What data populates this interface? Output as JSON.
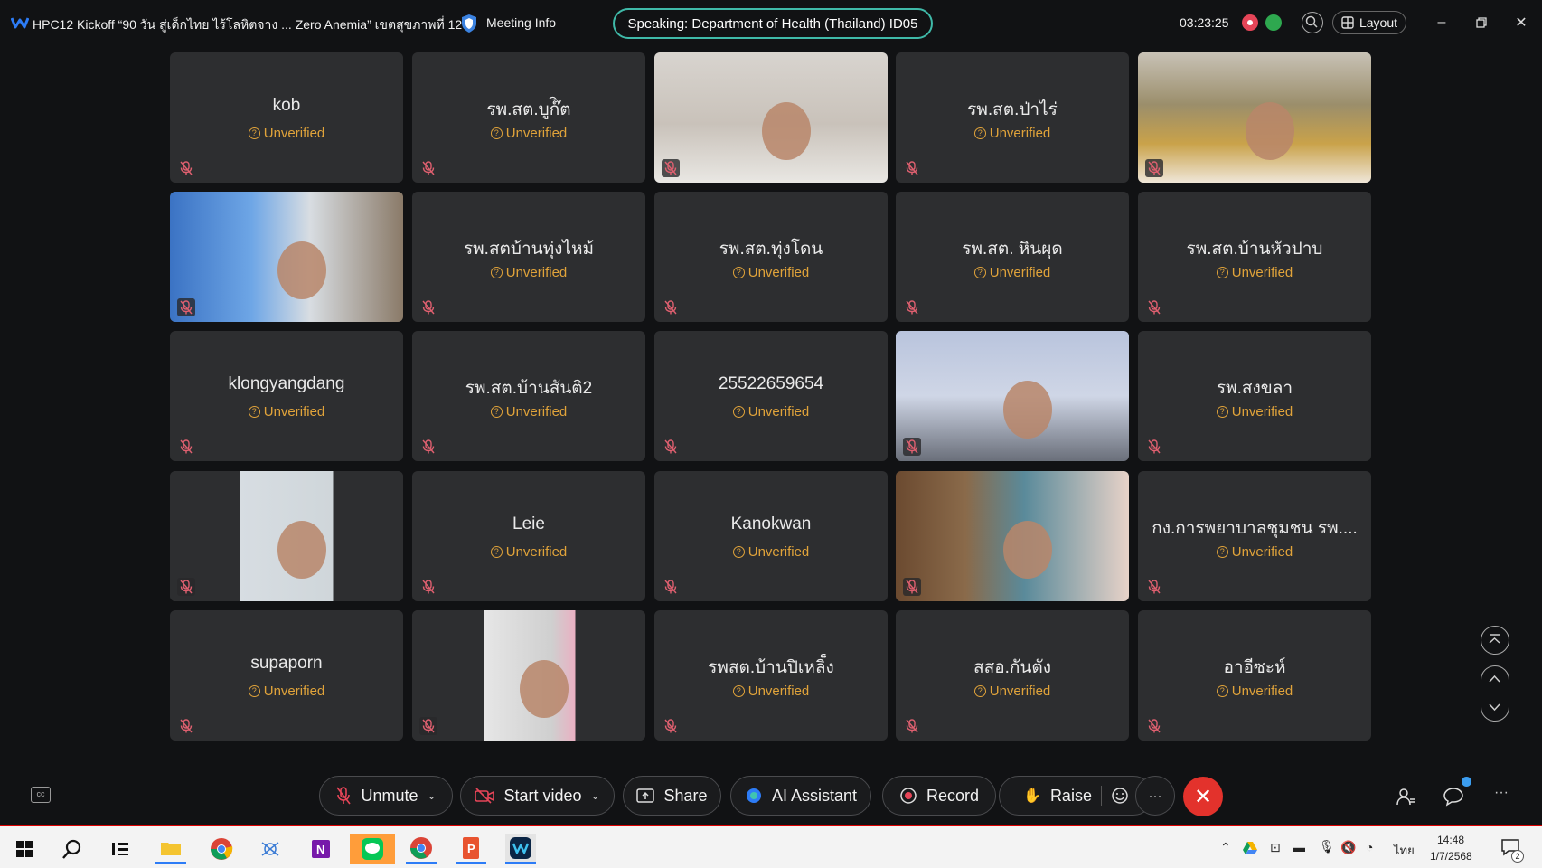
{
  "window": {
    "title": "HPC12 Kickoff “90 วัน สู่เด็กไทย ไร้โลหิตจาง ... Zero Anemia” เขตสุขภาพที่ 12",
    "meeting_info_label": "Meeting Info",
    "speaking_label": "Speaking: Department of Health (Thailand) ID05",
    "timer": "03:23:25",
    "layout_label": "Layout"
  },
  "status_label": "Unverified",
  "participants": [
    {
      "name": "kob",
      "video": false
    },
    {
      "name": "รพ.สต.บูก๊ิต",
      "video": false
    },
    {
      "name": "",
      "video": true
    },
    {
      "name": "รพ.สต.ป่าไร่",
      "video": false
    },
    {
      "name": "",
      "video": true
    },
    {
      "name": "",
      "video": true
    },
    {
      "name": "รพ.สตบ้านทุ่งไหม้",
      "video": false
    },
    {
      "name": "รพ.สต.ทุ่งโดน",
      "video": false
    },
    {
      "name": "รพ.สต. หินผุด",
      "video": false
    },
    {
      "name": "รพ.สต.บ้านหัวปาบ",
      "video": false
    },
    {
      "name": "klongyangdang",
      "video": false
    },
    {
      "name": "รพ.สต.บ้านสันติ2",
      "video": false
    },
    {
      "name": "25522659654",
      "video": false
    },
    {
      "name": "",
      "video": true
    },
    {
      "name": "รพ.สงขลา",
      "video": false
    },
    {
      "name": "",
      "video": true
    },
    {
      "name": "Leie",
      "video": false
    },
    {
      "name": "Kanokwan",
      "video": false
    },
    {
      "name": "",
      "video": true
    },
    {
      "name": "กง.การพยาบาลชุมชน รพ....",
      "video": false
    },
    {
      "name": "supaporn",
      "video": false
    },
    {
      "name": "",
      "video": true
    },
    {
      "name": "รพสต.บ้านปิเหลิ็ง",
      "video": false
    },
    {
      "name": "สสอ.กันตัง",
      "video": false
    },
    {
      "name": "อาอีซะห์",
      "video": false
    }
  ],
  "toolbar": {
    "unmute": "Unmute",
    "start_video": "Start video",
    "share": "Share",
    "ai_assistant": "AI Assistant",
    "record": "Record",
    "raise": "Raise",
    "more": "···"
  },
  "taskbar": {
    "time": "14:48",
    "date": "1/7/2568",
    "lang": "ไทย",
    "notifications": "2"
  },
  "colors": {
    "accent_teal": "#3fb9a8",
    "unverified": "#e0a33a",
    "end_red": "#e3322c"
  }
}
